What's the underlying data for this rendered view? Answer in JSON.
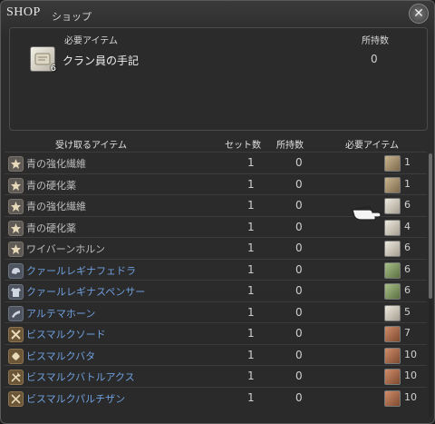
{
  "window": {
    "title": "SHOP",
    "subtitle": "ショップ",
    "close_icon": "close-icon"
  },
  "required": {
    "header_item": "必要アイテム",
    "header_owned": "所持数",
    "item_name": "クラン員の手記",
    "item_qty": "6",
    "owned": "0"
  },
  "columns": {
    "receive": "受け取るアイテム",
    "set_count": "セット数",
    "owned": "所持数",
    "required": "必要アイテム"
  },
  "rows": [
    {
      "name": "青の強化繊維",
      "set": "1",
      "owned": "0",
      "cost_icon": "pouch",
      "cost": "1",
      "icon": "star",
      "color": "gray"
    },
    {
      "name": "青の硬化薬",
      "set": "1",
      "owned": "0",
      "cost_icon": "pouch",
      "cost": "1",
      "icon": "star",
      "color": "gray"
    },
    {
      "name": "青の強化繊維",
      "set": "1",
      "owned": "0",
      "cost_icon": "scroll",
      "cost": "6",
      "icon": "star",
      "color": "gray"
    },
    {
      "name": "青の硬化薬",
      "set": "1",
      "owned": "0",
      "cost_icon": "scroll",
      "cost": "4",
      "icon": "star",
      "color": "gray"
    },
    {
      "name": "ワイバーンホルン",
      "set": "1",
      "owned": "0",
      "cost_icon": "scroll",
      "cost": "6",
      "icon": "star",
      "color": "gray"
    },
    {
      "name": "クァールレギナフェドラ",
      "set": "1",
      "owned": "0",
      "cost_icon": "leaf",
      "cost": "6",
      "icon": "helm",
      "color": "blue"
    },
    {
      "name": "クァールレギナスペンサー",
      "set": "1",
      "owned": "0",
      "cost_icon": "leaf",
      "cost": "6",
      "icon": "shirt",
      "color": "blue"
    },
    {
      "name": "アルテマホーン",
      "set": "1",
      "owned": "0",
      "cost_icon": "scroll",
      "cost": "5",
      "icon": "horn",
      "color": "blue"
    },
    {
      "name": "ビスマルクソード",
      "set": "1",
      "owned": "0",
      "cost_icon": "box",
      "cost": "7",
      "icon": "sword",
      "color": "blue"
    },
    {
      "name": "ビスマルクバタ",
      "set": "1",
      "owned": "0",
      "cost_icon": "box",
      "cost": "10",
      "icon": "fist",
      "color": "blue"
    },
    {
      "name": "ビスマルクバトルアクス",
      "set": "1",
      "owned": "0",
      "cost_icon": "box",
      "cost": "10",
      "icon": "axe",
      "color": "blue"
    },
    {
      "name": "ビスマルクパルチザン",
      "set": "1",
      "owned": "0",
      "cost_icon": "box",
      "cost": "10",
      "icon": "spear",
      "color": "blue"
    }
  ],
  "colors": {
    "blue_text": "#6f9fdd",
    "gray_text": "#bdbdbd"
  }
}
